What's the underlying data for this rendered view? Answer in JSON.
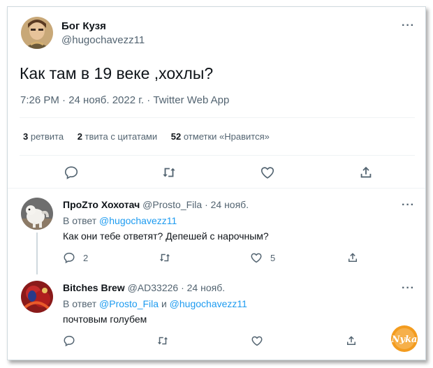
{
  "main_tweet": {
    "display_name": "Бог Кузя",
    "handle": "@hugochavezz11",
    "text": "Как там в 19 веке ,хохлы?",
    "meta": "7:26 PM · 24 нояб. 2022 г. · Twitter Web App",
    "stats": {
      "retweets_count": "3",
      "retweets_label": "ретвита",
      "quotes_count": "2",
      "quotes_label": "твита с цитатами",
      "likes_count": "52",
      "likes_label": "отметки «Нравится»"
    }
  },
  "replies": [
    {
      "display_name": "ПроZто Хохотач",
      "handle": "@Prosto_Fila",
      "date": "· 24 нояб.",
      "reply_prefix": "В ответ",
      "reply_to_1": "@hugochavezz11",
      "reply_joiner": "",
      "reply_to_2": "",
      "text": "Как они тебе ответят? Депешей с нарочным?",
      "reply_count": "2",
      "like_count": "5"
    },
    {
      "display_name": "Bitches Brew",
      "handle": "@AD33226",
      "date": "· 24 нояб.",
      "reply_prefix": "В ответ",
      "reply_to_1": "@Prosto_Fila",
      "reply_joiner": "и",
      "reply_to_2": "@hugochavezz11",
      "text": "почтовым голубем",
      "reply_count": "",
      "like_count": ""
    }
  ],
  "watermark": "Nyka",
  "colors": {
    "accent": "#1d9bf0",
    "muted": "#536471",
    "border": "#eff3f4",
    "watermark": "#f39c1f"
  },
  "icons": [
    "more-icon",
    "reply-icon",
    "retweet-icon",
    "like-icon",
    "share-icon"
  ]
}
